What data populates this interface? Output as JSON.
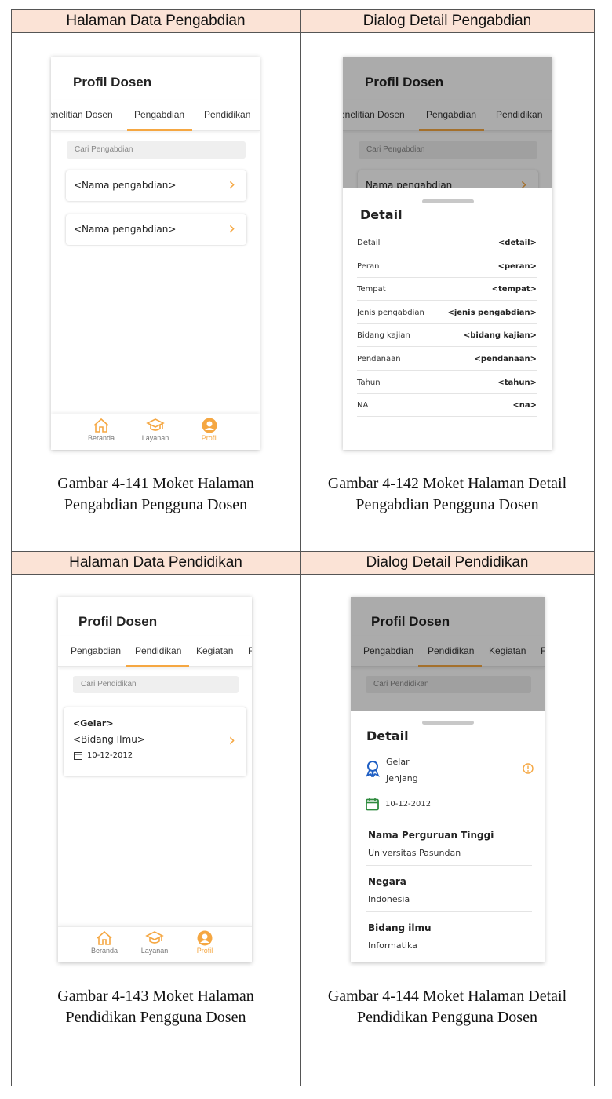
{
  "headers": {
    "top_left": "Halaman Data Pengabdian",
    "top_right": "Dialog Detail Pengabdian",
    "bottom_left": "Halaman Data Pendidikan",
    "bottom_right": "Dialog Detail Pendidikan"
  },
  "captions": {
    "fig141": [
      "Gambar 4-141 Moket Halaman",
      "Pengabdian Pengguna Dosen"
    ],
    "fig142": [
      "Gambar 4-142 Moket Halaman Detail",
      "Pengabdian Pengguna Dosen"
    ],
    "fig143": [
      "Gambar 4-143 Moket Halaman",
      "Pendidikan Pengguna Dosen"
    ],
    "fig144": [
      "Gambar 4-144 Moket Halaman Detail",
      "Pendidikan Pengguna Dosen"
    ]
  },
  "app_title": "Profil Dosen",
  "colors": {
    "accent": "#f5a742",
    "header_bg": "#fbe3d6",
    "success_green": "#2e8b3e",
    "icon_blue": "#1f5fc4"
  },
  "pengabdian_screen": {
    "tabs": [
      "enelitian Dosen",
      "Pengabdian",
      "Pendidikan"
    ],
    "active_tab": "Pengabdian",
    "search_placeholder": "Cari Pengabdian",
    "items": [
      "<Nama pengabdian>",
      "<Nama pengabdian>"
    ],
    "nav": [
      "Beranda",
      "Layanan",
      "Profil"
    ],
    "active_nav": "Profil"
  },
  "pengabdian_detail": {
    "background_item": "Nama pengabdian",
    "title": "Detail",
    "rows": [
      {
        "label": "Detail",
        "value": "<detail>"
      },
      {
        "label": "Peran",
        "value": "<peran>"
      },
      {
        "label": "Tempat",
        "value": "<tempat>"
      },
      {
        "label": "Jenis pengabdian",
        "value": "<jenis pengabdian>"
      },
      {
        "label": "Bidang kajian",
        "value": "<bidang kajian>"
      },
      {
        "label": "Pendanaan",
        "value": "<pendanaan>"
      },
      {
        "label": "Tahun",
        "value": "<tahun>"
      },
      {
        "label": "NA",
        "value": "<na>"
      }
    ]
  },
  "pendidikan_screen": {
    "tabs": [
      "Pengabdian",
      "Pendidikan",
      "Kegiatan",
      "F"
    ],
    "active_tab": "Pendidikan",
    "search_placeholder": "Cari Pendidikan",
    "card": {
      "gelar": "<Gelar>",
      "bidang": "<Bidang Ilmu>",
      "date": "10-12-2012"
    },
    "nav": [
      "Beranda",
      "Layanan",
      "Profil"
    ],
    "active_nav": "Profil"
  },
  "pendidikan_detail": {
    "title": "Detail",
    "gelar_label": "Gelar",
    "jenjang_label": "Jenjang",
    "date": "10-12-2012",
    "sections": [
      {
        "label": "Nama Perguruan Tinggi",
        "value": "Universitas Pasundan"
      },
      {
        "label": "Negara",
        "value": "Indonesia"
      },
      {
        "label": "Bidang ilmu",
        "value": "Informatika"
      }
    ]
  }
}
